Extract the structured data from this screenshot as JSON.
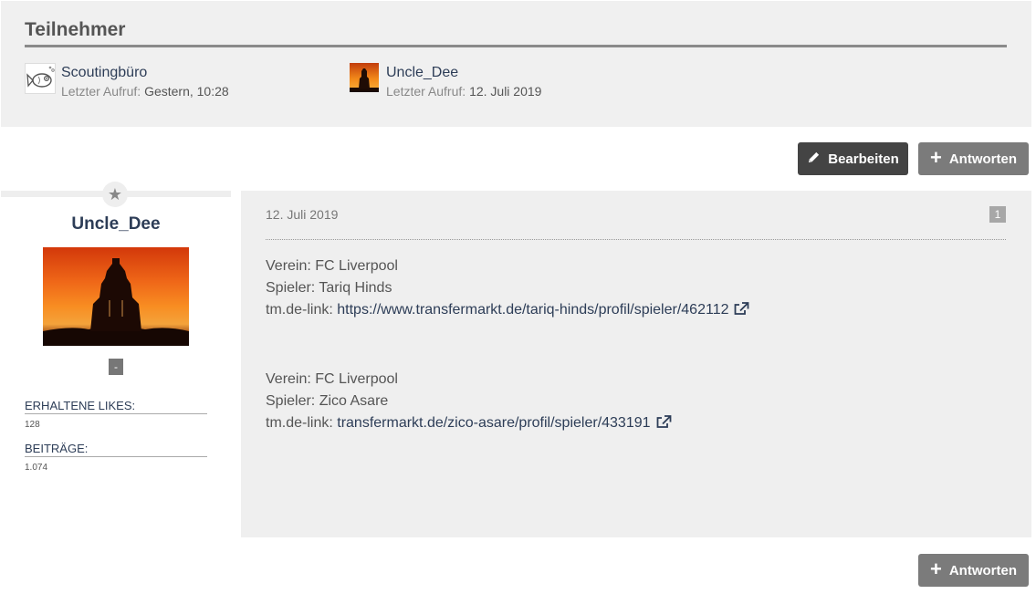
{
  "participants": {
    "title": "Teilnehmer",
    "items": [
      {
        "name": "Scoutingbüro",
        "seen_label": "Letzter Aufruf:",
        "seen_value": "Gestern, 10:28"
      },
      {
        "name": "Uncle_Dee",
        "seen_label": "Letzter Aufruf:",
        "seen_value": "12. Juli 2019"
      }
    ]
  },
  "toolbar": {
    "edit_label": "Bearbeiten",
    "reply_label": "Antworten"
  },
  "author": {
    "name": "Uncle_Dee",
    "rank": "-",
    "likes_label": "ERHALTENE LIKES:",
    "likes_value": "128",
    "posts_label": "BEITRÄGE:",
    "posts_value": "1.074"
  },
  "post": {
    "date": "12. Juli 2019",
    "number": "1",
    "lines": [
      {
        "label": "Verein:",
        "value": "FC Liverpool"
      },
      {
        "label": "Spieler:",
        "value": "Tariq Hinds"
      },
      {
        "label": "tm.de-link:",
        "link": "https://www.transfermarkt.de/tariq-hinds/profil/spieler/462112"
      },
      {
        "label": "Verein:",
        "value": "FC Liverpool"
      },
      {
        "label": "Spieler:",
        "value": "Zico Asare"
      },
      {
        "label": "tm.de-link:",
        "link": "transfermarkt.de/zico-asare/profil/spieler/433191"
      }
    ]
  },
  "colors": {
    "accent": "#2d3d57",
    "panel": "#f0f0f0",
    "edit_button": "#444444",
    "reply_button": "#7b7b7b"
  }
}
